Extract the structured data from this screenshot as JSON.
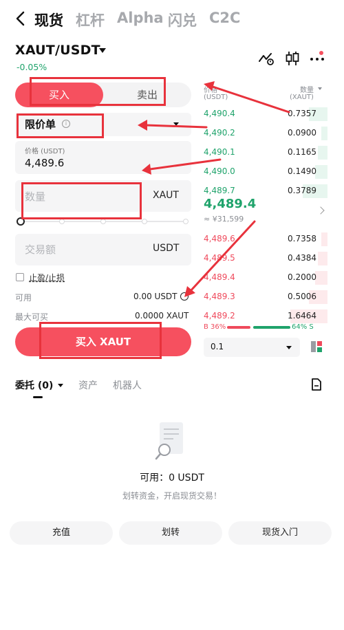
{
  "nav": {
    "tabs": [
      "现货",
      "杠杆",
      "Alpha",
      "闪兑",
      "C2C"
    ],
    "active": "现货"
  },
  "pair": {
    "symbol": "XAUT/USDT",
    "change": "-0.05%"
  },
  "trade": {
    "buy_label": "买入",
    "sell_label": "卖出",
    "order_type": "限价单",
    "price_caption": "价格 (USDT)",
    "price_value": "4,489.6",
    "qty_placeholder": "数量",
    "qty_unit": "XAUT",
    "amount_placeholder": "交易额",
    "amount_unit": "USDT",
    "tpsl_label": "止盈/止损",
    "available_label": "可用",
    "available_value": "0.00 USDT",
    "max_buy_label": "最大可买",
    "max_buy_value": "0.0000 XAUT",
    "submit_label": "买入 XAUT"
  },
  "orderbook": {
    "price_header": "价格",
    "price_unit": "(USDT)",
    "qty_header": "数量",
    "qty_unit": "(XAUT)",
    "bids": [
      {
        "price": "4,490.4",
        "qty": "0.7357",
        "depth": 0.15
      },
      {
        "price": "4,490.2",
        "qty": "0.0900",
        "depth": 0.05
      },
      {
        "price": "4,490.1",
        "qty": "0.1165",
        "depth": 0.08
      },
      {
        "price": "4,490.0",
        "qty": "0.1490",
        "depth": 0.1
      },
      {
        "price": "4,489.7",
        "qty": "0.3789",
        "depth": 0.2
      }
    ],
    "mid_price": "4,489.4",
    "mid_fiat": "≈ ¥31,599",
    "asks": [
      {
        "price": "4,489.6",
        "qty": "0.7358",
        "depth": 0.05
      },
      {
        "price": "4,489.5",
        "qty": "0.4384",
        "depth": 0.08
      },
      {
        "price": "4,489.4",
        "qty": "0.2000",
        "depth": 0.1
      },
      {
        "price": "4,489.3",
        "qty": "0.5006",
        "depth": 0.15
      },
      {
        "price": "4,489.2",
        "qty": "1.6464",
        "depth": 0.3
      }
    ],
    "buy_ratio": "B 36%",
    "sell_ratio": "64% S",
    "precision": "0.1"
  },
  "bottom": {
    "tabs": [
      "委托 (0)",
      "资产",
      "机器人"
    ],
    "available_text": "可用：0 USDT",
    "hint_text": "划转资金，开启现货交易！",
    "buttons": [
      "充值",
      "划转",
      "现货入门"
    ]
  },
  "colors": {
    "buy": "#f6505f",
    "green": "#1fa36b",
    "annotation": "#e8323c"
  }
}
